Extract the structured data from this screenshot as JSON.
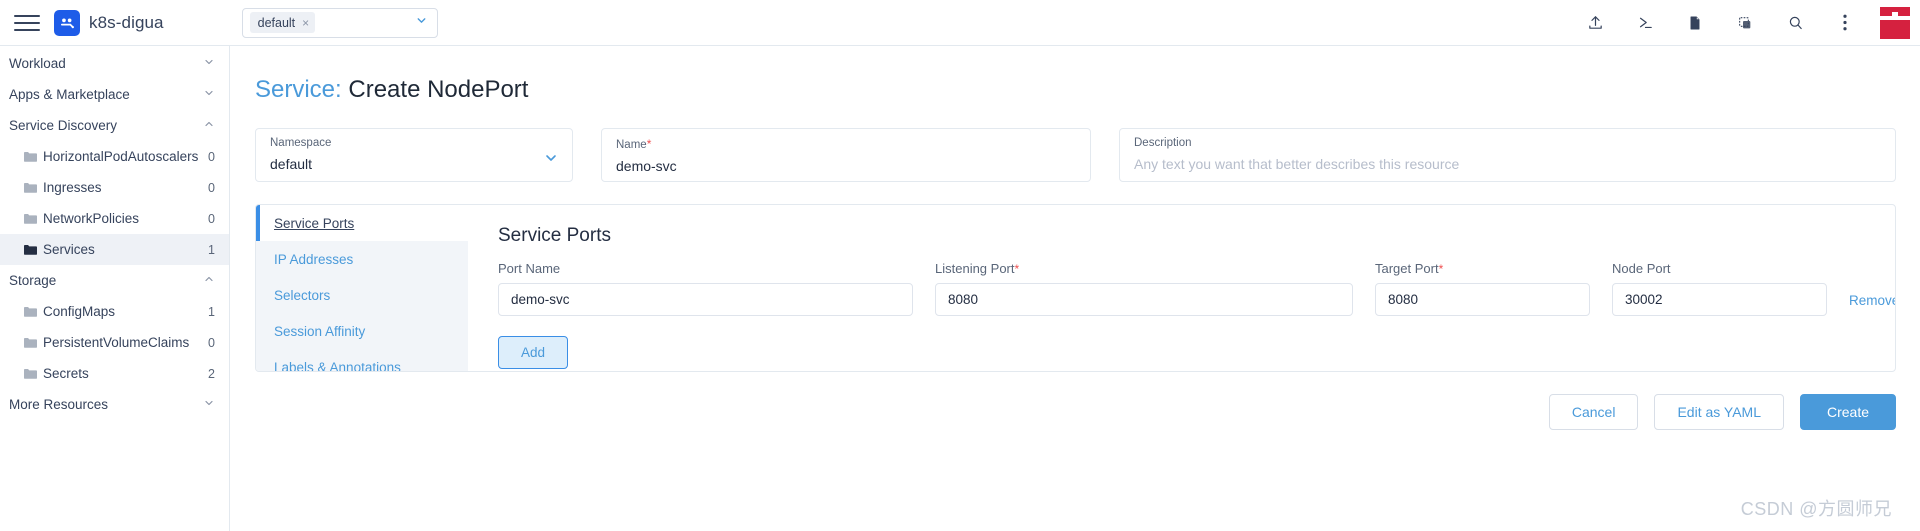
{
  "topbar": {
    "menu_icon": "hamburger-menu-icon",
    "logo_icon": "kubesphere-logo-icon",
    "brand": "k8s-digua",
    "namespace_selector": {
      "chip_label": "default",
      "chip_close": "×",
      "caret_icon": "chevron-down-icon"
    },
    "icons": [
      {
        "name": "upload-icon",
        "glyph": "upload"
      },
      {
        "name": "terminal-icon",
        "glyph": "terminal"
      },
      {
        "name": "document-icon",
        "glyph": "document"
      },
      {
        "name": "copy-icon",
        "glyph": "copy"
      },
      {
        "name": "search-icon",
        "glyph": "search"
      },
      {
        "name": "more-options-icon",
        "glyph": "kebab"
      }
    ],
    "avatar_icon": "user-avatar-logo"
  },
  "sidebar": {
    "groups": [
      {
        "label": "Workload",
        "caret": "chevron-down-icon",
        "items": []
      },
      {
        "label": "Apps & Marketplace",
        "caret": "chevron-down-icon",
        "items": []
      },
      {
        "label": "Service Discovery",
        "caret": "chevron-up-icon",
        "items": [
          {
            "label": "HorizontalPodAutoscalers",
            "count": "0",
            "active": false
          },
          {
            "label": "Ingresses",
            "count": "0",
            "active": false
          },
          {
            "label": "NetworkPolicies",
            "count": "0",
            "active": false
          },
          {
            "label": "Services",
            "count": "1",
            "active": true
          }
        ]
      },
      {
        "label": "Storage",
        "caret": "chevron-up-icon",
        "items": [
          {
            "label": "ConfigMaps",
            "count": "1",
            "active": false
          },
          {
            "label": "PersistentVolumeClaims",
            "count": "0",
            "active": false
          },
          {
            "label": "Secrets",
            "count": "2",
            "active": false
          }
        ]
      },
      {
        "label": "More Resources",
        "caret": "chevron-down-icon",
        "items": []
      }
    ]
  },
  "page": {
    "title_prefix": "Service:",
    "title_main": "Create NodePort"
  },
  "top_fields": {
    "namespace": {
      "label": "Namespace",
      "value": "default",
      "caret_icon": "chevron-down-icon"
    },
    "name": {
      "label": "Name",
      "required": "*",
      "value": "demo-svc"
    },
    "description": {
      "label": "Description",
      "placeholder": "Any text you want that better describes this resource"
    }
  },
  "panel": {
    "tabs": [
      {
        "label": "Service Ports",
        "active": true
      },
      {
        "label": "IP Addresses",
        "active": false
      },
      {
        "label": "Selectors",
        "active": false
      },
      {
        "label": "Session Affinity",
        "active": false
      },
      {
        "label": "Labels & Annotations",
        "active": false
      }
    ],
    "heading": "Service Ports",
    "columns": [
      {
        "label": "Port Name",
        "required": ""
      },
      {
        "label": "Listening Port",
        "required": "*"
      },
      {
        "label": "Target Port",
        "required": "*"
      },
      {
        "label": "Node Port",
        "required": ""
      }
    ],
    "row": {
      "port_name": "demo-svc",
      "listening_port": "8080",
      "target_port": "8080",
      "node_port": "30002",
      "remove_label": "Remove"
    },
    "add_label": "Add"
  },
  "actions": {
    "cancel": "Cancel",
    "edit_yaml": "Edit as YAML",
    "create": "Create"
  },
  "watermark": "CSDN @方圆师兄",
  "colors": {
    "accent_blue": "#4a9ada",
    "brand_blue": "#1e5ce8",
    "required_red": "#ef4f4f",
    "logo_red": "#d5213f",
    "text_dark": "#242e42",
    "text_muted": "#5a6679"
  }
}
